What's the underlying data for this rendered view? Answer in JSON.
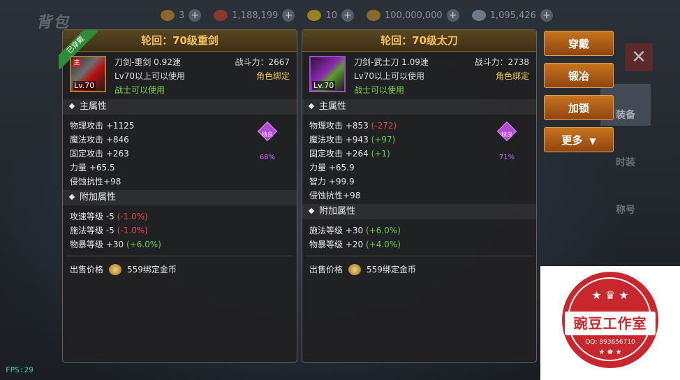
{
  "header": {
    "bg_title": "背包",
    "currencies": [
      {
        "icon": "gold-coin-icon",
        "value": "3"
      },
      {
        "icon": "ticket-icon",
        "value": "1,188,199"
      },
      {
        "icon": "medal-icon",
        "value": "10"
      },
      {
        "icon": "bound-gold-icon",
        "value": "100,000,000"
      },
      {
        "icon": "crystal-icon",
        "value": "1,095,426"
      }
    ]
  },
  "right_tabs": [
    "装备",
    "时装",
    "称号"
  ],
  "left_item": {
    "title": "轮回：70级重剑",
    "equipped_tag": "已穿戴",
    "icon_level": "Lv.70",
    "icon_tag": "主",
    "type_speed": "刀剑-重剑   0.92速",
    "level_req": "Lv70以上可以使用",
    "class_req": "战士可以使用",
    "power": "战斗力：2667",
    "bind": "角色绑定",
    "quality_name": "精良",
    "quality_pct": "68%",
    "main_title": "主属性",
    "main_stats": [
      {
        "text": "物理攻击 +1125",
        "delta": "",
        "delta_class": ""
      },
      {
        "text": "魔法攻击 +846",
        "delta": "",
        "delta_class": ""
      },
      {
        "text": "固定攻击 +263",
        "delta": "",
        "delta_class": ""
      },
      {
        "text": "力量 +65.5",
        "delta": "",
        "delta_class": ""
      },
      {
        "text": "侵蚀抗性+98",
        "delta": "",
        "delta_class": ""
      }
    ],
    "extra_title": "附加属性",
    "extra_stats": [
      {
        "text": "攻速等级 -5 ",
        "delta": "(-1.0%)",
        "delta_class": "red"
      },
      {
        "text": "施法等级 -5 ",
        "delta": "(-1.0%)",
        "delta_class": "red"
      },
      {
        "text": "物暴等级 +30 ",
        "delta": "(+6.0%)",
        "delta_class": "pos"
      }
    ],
    "sell_label": "出售价格",
    "sell_price": "559绑定金币"
  },
  "right_item": {
    "title": "轮回：70级太刀",
    "icon_level": "Lv.70",
    "type_speed": "刀剑-武士刀   1.09速",
    "level_req": "Lv70以上可以使用",
    "class_req": "战士可以使用",
    "power": "战斗力：2738",
    "bind": "角色绑定",
    "quality_name": "精良",
    "quality_pct": "71%",
    "main_title": "主属性",
    "main_stats": [
      {
        "text": "物理攻击 +853 ",
        "delta": "(-272)",
        "delta_class": "red"
      },
      {
        "text": "魔法攻击 +943 ",
        "delta": "(+97)",
        "delta_class": "pos"
      },
      {
        "text": "固定攻击 +264 ",
        "delta": "(+1)",
        "delta_class": "pos"
      },
      {
        "text": "力量 +65.9",
        "delta": "",
        "delta_class": ""
      },
      {
        "text": "智力 +99.9",
        "delta": "",
        "delta_class": ""
      },
      {
        "text": "侵蚀抗性+98",
        "delta": "",
        "delta_class": ""
      }
    ],
    "extra_title": "附加属性",
    "extra_stats": [
      {
        "text": "施法等级 +30 ",
        "delta": "(+6.0%)",
        "delta_class": "pos"
      },
      {
        "text": "物暴等级 +20 ",
        "delta": "(+4.0%)",
        "delta_class": "pos"
      }
    ],
    "sell_label": "出售价格",
    "sell_price": "559绑定金币"
  },
  "actions": {
    "equip": "穿戴",
    "forge": "锻冶",
    "lock": "加锁",
    "more": "更多"
  },
  "fps": "FPS:29",
  "watermark": {
    "title": "豌豆工作室",
    "qq": "QQ: 893656710"
  },
  "colors": {
    "gold_title": "#f0c060",
    "button": "#c8741c",
    "positive": "#62d04a",
    "negative": "#e24a4a",
    "quality_purple": "#b24ad4",
    "watermark_red": "#c8282d"
  }
}
